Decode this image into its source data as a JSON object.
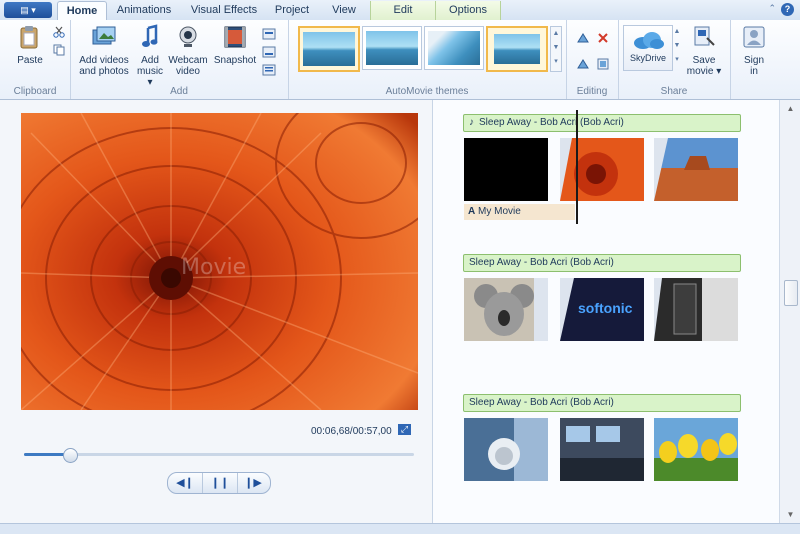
{
  "tabs": [
    {
      "label": "Home"
    },
    {
      "label": "Animations"
    },
    {
      "label": "Visual Effects"
    },
    {
      "label": "Project"
    },
    {
      "label": "View"
    },
    {
      "label": "Edit"
    },
    {
      "label": "Options"
    }
  ],
  "help_label": "?",
  "ribbon": {
    "clipboard": {
      "paste": "Paste",
      "group": "Clipboard"
    },
    "add": {
      "add_videos_line1": "Add videos",
      "add_videos_line2": "and photos",
      "add_music_line1": "Add",
      "add_music_line2": "music ▾",
      "webcam_line1": "Webcam",
      "webcam_line2": "video",
      "snapshot": "Snapshot",
      "group": "Add"
    },
    "themes": {
      "group": "AutoMovie themes"
    },
    "editing": {
      "group": "Editing"
    },
    "share": {
      "skydrive": "SkyDrive",
      "save_movie_line1": "Save",
      "save_movie_line2": "movie ▾",
      "group": "Share"
    },
    "sign_in_line1": "Sign",
    "sign_in_line2": "in"
  },
  "preview": {
    "watermark": "Movie",
    "timecode": "00:06,68/00:57,00",
    "progress": 0.117,
    "prev_icon": "◀❙",
    "pause_icon": "❙❙",
    "next_icon": "❙▶"
  },
  "storyboard": {
    "rows": [
      {
        "music": "Sleep Away - Bob Acri (Bob Acri)",
        "caption": "My Movie"
      },
      {
        "music": "Sleep Away - Bob Acri (Bob Acri)"
      },
      {
        "music": "Sleep Away - Bob Acri (Bob Acri)"
      }
    ],
    "softonic": "softonic",
    "music_note": "♪",
    "caption_icon": "A"
  },
  "colors": {
    "accent": "#2f67b5",
    "music_bar": "#d9f3c9",
    "theme_selected": "#f1b94b"
  }
}
